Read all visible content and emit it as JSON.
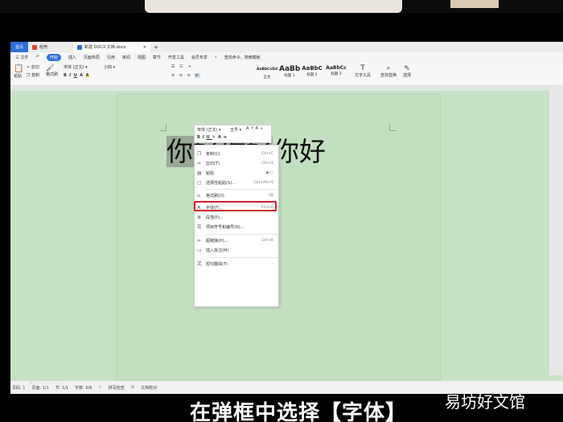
{
  "tabs": [
    {
      "label": "首页"
    },
    {
      "label": "稻壳"
    },
    {
      "label": "新建 DOCX 文档.docx"
    }
  ],
  "menu": [
    "三 文件",
    "开始",
    "插入",
    "页面布局",
    "引用",
    "审阅",
    "视图",
    "章节",
    "开发工具",
    "会员专享"
  ],
  "search_placeholder": "查找命令、搜索模板",
  "ribbon": {
    "paste": "粘贴",
    "cut": "剪切",
    "copy": "复制",
    "format_painter": "格式刷",
    "font_name": "宋体 (正文)",
    "font_size": "小四",
    "styles": [
      {
        "preview": "AaBbCcDd",
        "name": "正文"
      },
      {
        "preview": "AaBb",
        "name": "标题 1"
      },
      {
        "preview": "AaBbC",
        "name": "标题 2"
      },
      {
        "preview": "AaBbCc",
        "name": "标题 3"
      }
    ],
    "text_tools": "文字工具",
    "find_replace": "查找替换",
    "select": "选择"
  },
  "document": {
    "selected_text": "你好你好",
    "rest_text": "你好"
  },
  "minibar": {
    "font": "宋体 (正文)",
    "size": "五号"
  },
  "context_menu": [
    {
      "label": "复制(C)",
      "shortcut": "Ctrl+C"
    },
    {
      "label": "剪切(T)",
      "shortcut": "Ctrl+X"
    },
    {
      "label": "粘贴",
      "shortcut": ""
    },
    {
      "label": "选择性粘贴(S)...",
      "shortcut": "Ctrl+Alt+V"
    },
    {
      "label": "格式刷(O)",
      "shortcut": ""
    },
    {
      "label": "字体(F)...",
      "shortcut": "Ctrl+D"
    },
    {
      "label": "段落(P)...",
      "shortcut": ""
    },
    {
      "label": "项目符号和编号(N)...",
      "shortcut": ""
    },
    {
      "label": "超链接(H)...",
      "shortcut": "Ctrl+K"
    },
    {
      "label": "插入批注(M)",
      "shortcut": ""
    },
    {
      "label": "短句翻译(T)",
      "shortcut": ""
    }
  ],
  "status": {
    "page": "页码: 1",
    "pages": "页面: 1/1",
    "section": "节: 1/1",
    "words": "字数: 6/6",
    "spellcheck": "拼写检查",
    "doc_check": "文档校对"
  },
  "caption": "在弹框中选择【字体】",
  "brand": "易坊好文馆",
  "colors": {
    "accent": "#2f6fd6",
    "highlight": "#d21d2a",
    "page": "#c2dfc0"
  }
}
